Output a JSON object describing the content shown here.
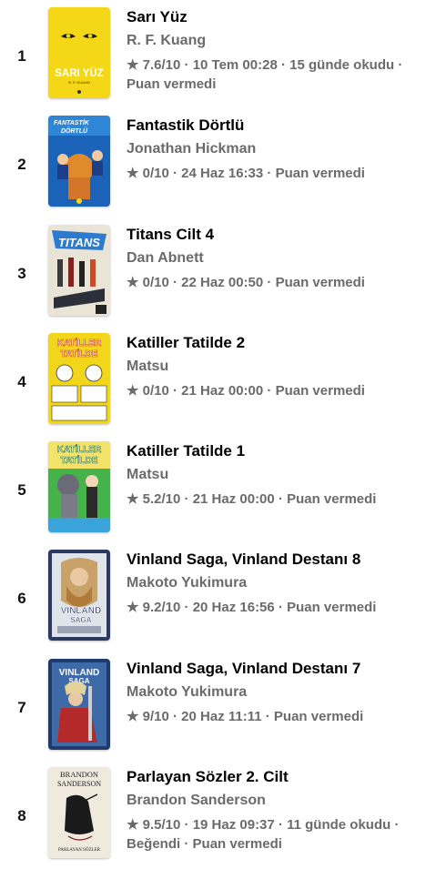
{
  "books": [
    {
      "rank": "1",
      "title": "Sarı Yüz",
      "author": "R. F. Kuang",
      "rating": "7.6/10",
      "date": "10 Tem 00:28",
      "extra": "15 günde okudu",
      "extra2": "Puan vermedi",
      "cover_title": "SARI YÜZ",
      "cover_author": "R. F. KUANG",
      "cover_color": "#f4d716"
    },
    {
      "rank": "2",
      "title": "Fantastik Dörtlü",
      "author": "Jonathan Hickman",
      "rating": "0/10",
      "date": "24 Haz 16:33",
      "extra": "Puan vermedi",
      "cover_title": "FANTASTİK DÖRTLÜ",
      "cover_color": "#1b63b8"
    },
    {
      "rank": "3",
      "title": "Titans Cilt 4",
      "author": "Dan Abnett",
      "rating": "0/10",
      "date": "22 Haz 00:50",
      "extra": "Puan vermedi",
      "cover_title": "TITANS",
      "cover_color": "#e9e4d6"
    },
    {
      "rank": "4",
      "title": "Katiller Tatilde 2",
      "author": "Matsu",
      "rating": "0/10",
      "date": "21 Haz 00:00",
      "extra": "Puan vermedi",
      "cover_title_1": "KATİLLER",
      "cover_title_2": "TATİLDE",
      "cover_color": "#f2d61a"
    },
    {
      "rank": "5",
      "title": "Katiller Tatilde 1",
      "author": "Matsu",
      "rating": "5.2/10",
      "date": "21 Haz 00:00",
      "extra": "Puan vermedi",
      "cover_title_1": "KATİLLER",
      "cover_title_2": "TATİLDE",
      "cover_color": "#45b24a"
    },
    {
      "rank": "6",
      "title": "Vinland Saga, Vinland Destanı 8",
      "author": "Makoto Yukimura",
      "rating": "9.2/10",
      "date": "20 Haz 16:56",
      "extra": "Puan vermedi",
      "cover_title_1": "VINLAND",
      "cover_title_2": "SAGA",
      "cover_color": "#2c3a63"
    },
    {
      "rank": "7",
      "title": "Vinland Saga, Vinland Destanı 7",
      "author": "Makoto Yukimura",
      "rating": "9/10",
      "date": "20 Haz 11:11",
      "extra": "Puan vermedi",
      "cover_title_1": "VINLAND",
      "cover_title_2": "SAGA",
      "cover_color": "#1e3a6e"
    },
    {
      "rank": "8",
      "title": "Parlayan Sözler 2. Cilt",
      "author": "Brandon Sanderson",
      "rating": "9.5/10",
      "date": "19 Haz 09:37",
      "extra": "11 günde okudu",
      "extra2": "Beğendi",
      "extra3": "Puan vermedi",
      "cover_title_1": "BRANDON",
      "cover_title_2": "SANDERSON",
      "cover_subtitle": "PARLAYAN SÖZLER",
      "cover_color": "#efe9de"
    }
  ],
  "separator": " · ",
  "icons": {
    "rating": "star-icon"
  },
  "colors": {
    "title": "#000000",
    "secondary": "#6b6b6b",
    "background": "#ffffff"
  }
}
